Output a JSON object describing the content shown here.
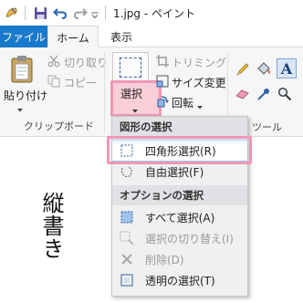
{
  "title_bar": {
    "title": "1.jpg - ペイント"
  },
  "tabs": {
    "file": "ファイル",
    "home": "ホーム",
    "view": "表示"
  },
  "clipboard": {
    "paste": "貼り付け",
    "cut": "切り取り",
    "copy": "コピー",
    "group_label": "クリップボード"
  },
  "image_group": {
    "select": "選択",
    "crop": "トリミング",
    "resize": "サイズ変更",
    "rotate": "回転"
  },
  "tools": {
    "group_label": "ツール"
  },
  "canvas": {
    "text": "縦書き"
  },
  "select_menu": {
    "header_shapes": "図形の選択",
    "rect_select": "四角形選択(R)",
    "free_select": "自由選択(F)",
    "header_options": "オプションの選択",
    "select_all": "すべて選択(A)",
    "invert_select": "選択の切り替え(I)",
    "delete": "削除(D)",
    "transparent_select": "透明の選択(T)"
  },
  "colors": {
    "accent_blue": "#1979ca",
    "highlight_pink": "#f096b7",
    "ribbon_bg": "#f5f6f7"
  }
}
